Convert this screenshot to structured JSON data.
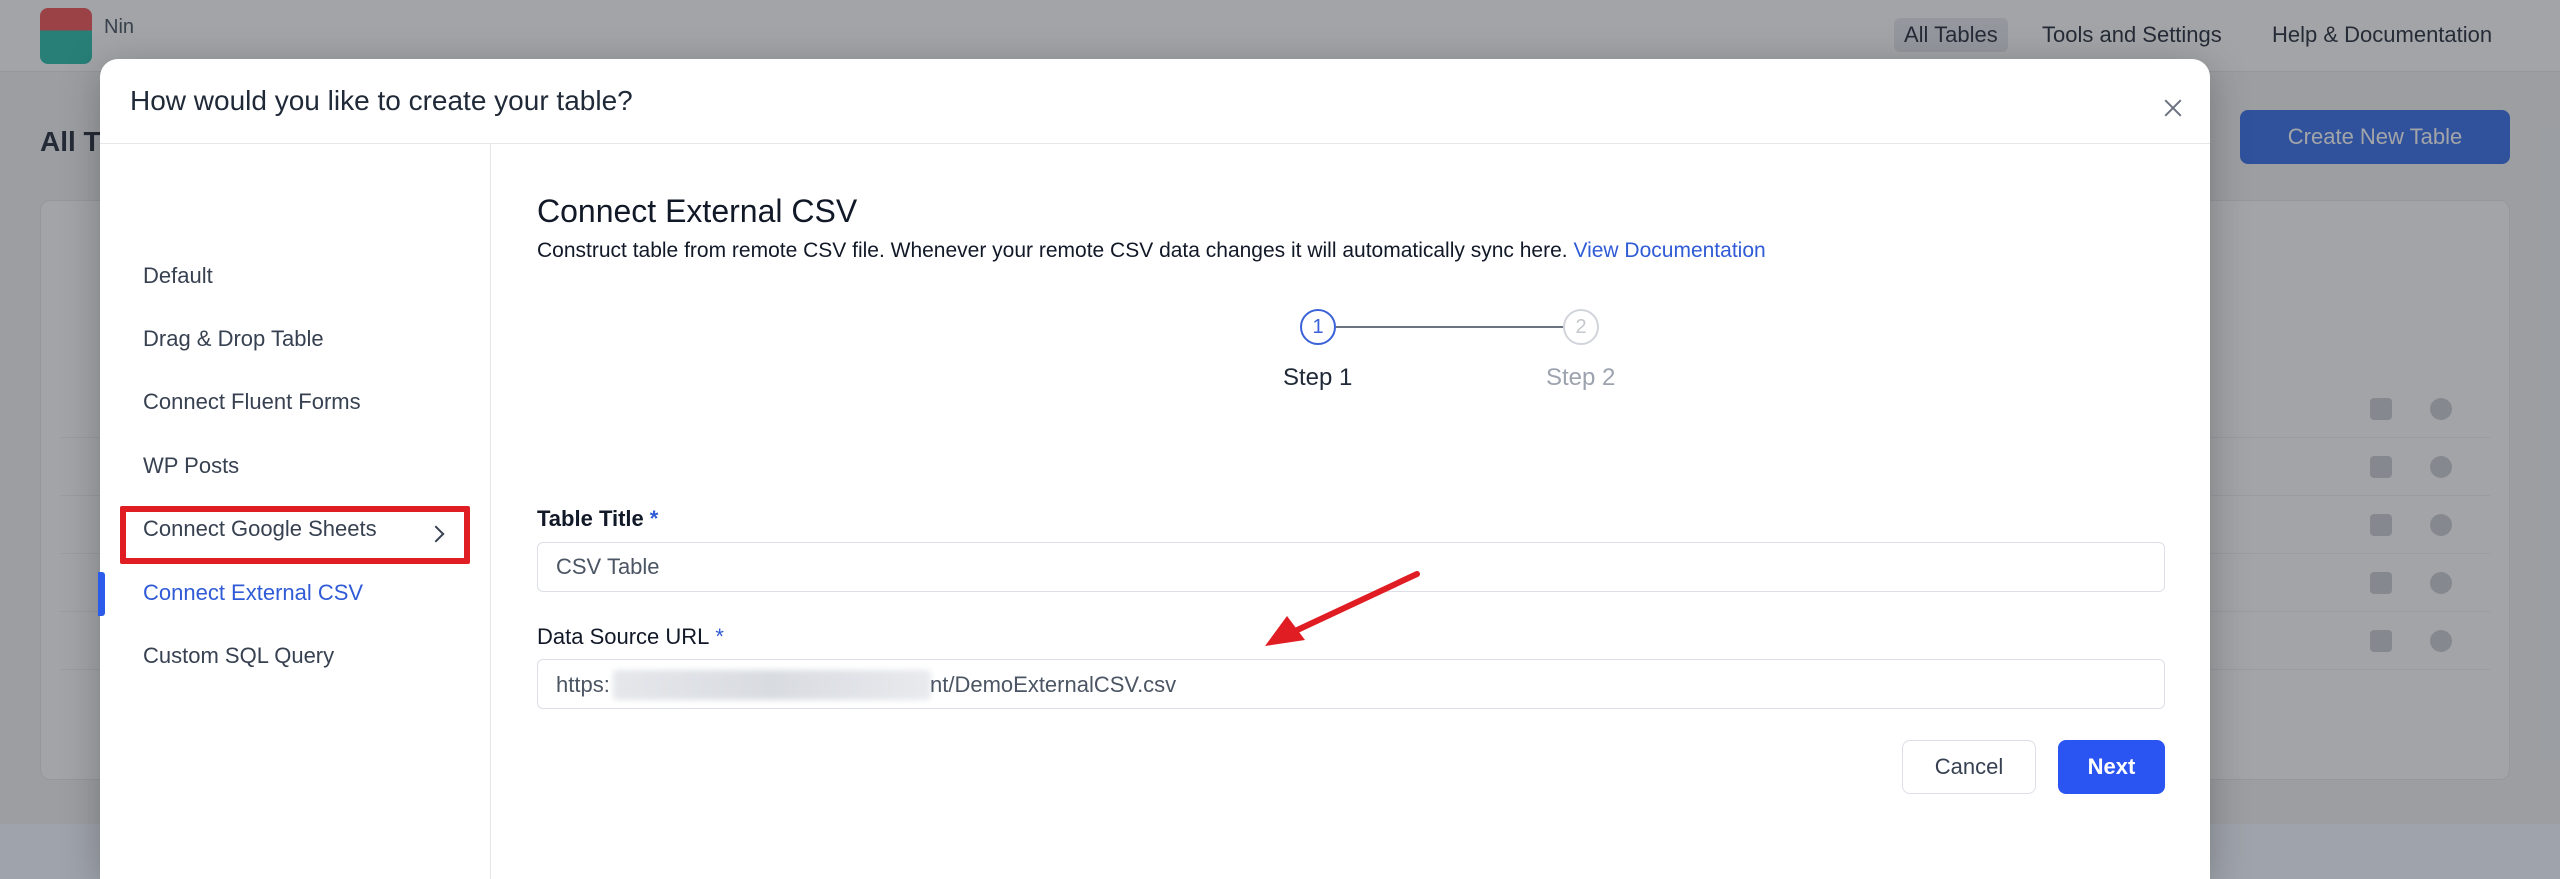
{
  "background": {
    "brand": "Nin",
    "nav": [
      "All Tables",
      "Tools and Settings",
      "Help & Documentation"
    ],
    "heading": "All T",
    "create_button": "Create New Table"
  },
  "modal": {
    "title": "How would you like to create your table?",
    "sidebar": {
      "items": [
        {
          "label": "Default"
        },
        {
          "label": "Drag & Drop Table"
        },
        {
          "label": "Connect Fluent Forms"
        },
        {
          "label": "WP Posts"
        },
        {
          "label": "Connect Google Sheets"
        },
        {
          "label": "Connect External CSV"
        },
        {
          "label": "Custom SQL Query"
        }
      ],
      "active_index": 5
    },
    "content": {
      "title": "Connect External CSV",
      "description": "Construct table from remote CSV file. Whenever your remote CSV data changes it will automatically sync here.",
      "doc_link": "View Documentation",
      "steps": [
        {
          "number": "1",
          "label": "Step 1"
        },
        {
          "number": "2",
          "label": "Step 2"
        }
      ],
      "current_step": 1,
      "table_title": {
        "label": "Table Title",
        "required_mark": "*",
        "value": "CSV Table"
      },
      "data_source_url": {
        "label": "Data Source URL",
        "required_mark": "*",
        "value_prefix": "https:",
        "value_suffix": "nt/DemoExternalCSV.csv"
      },
      "cancel_label": "Cancel",
      "next_label": "Next"
    }
  },
  "colors": {
    "accent": "#2b55f2",
    "link": "#2f5bd6",
    "annotation_red": "#e11d24"
  }
}
